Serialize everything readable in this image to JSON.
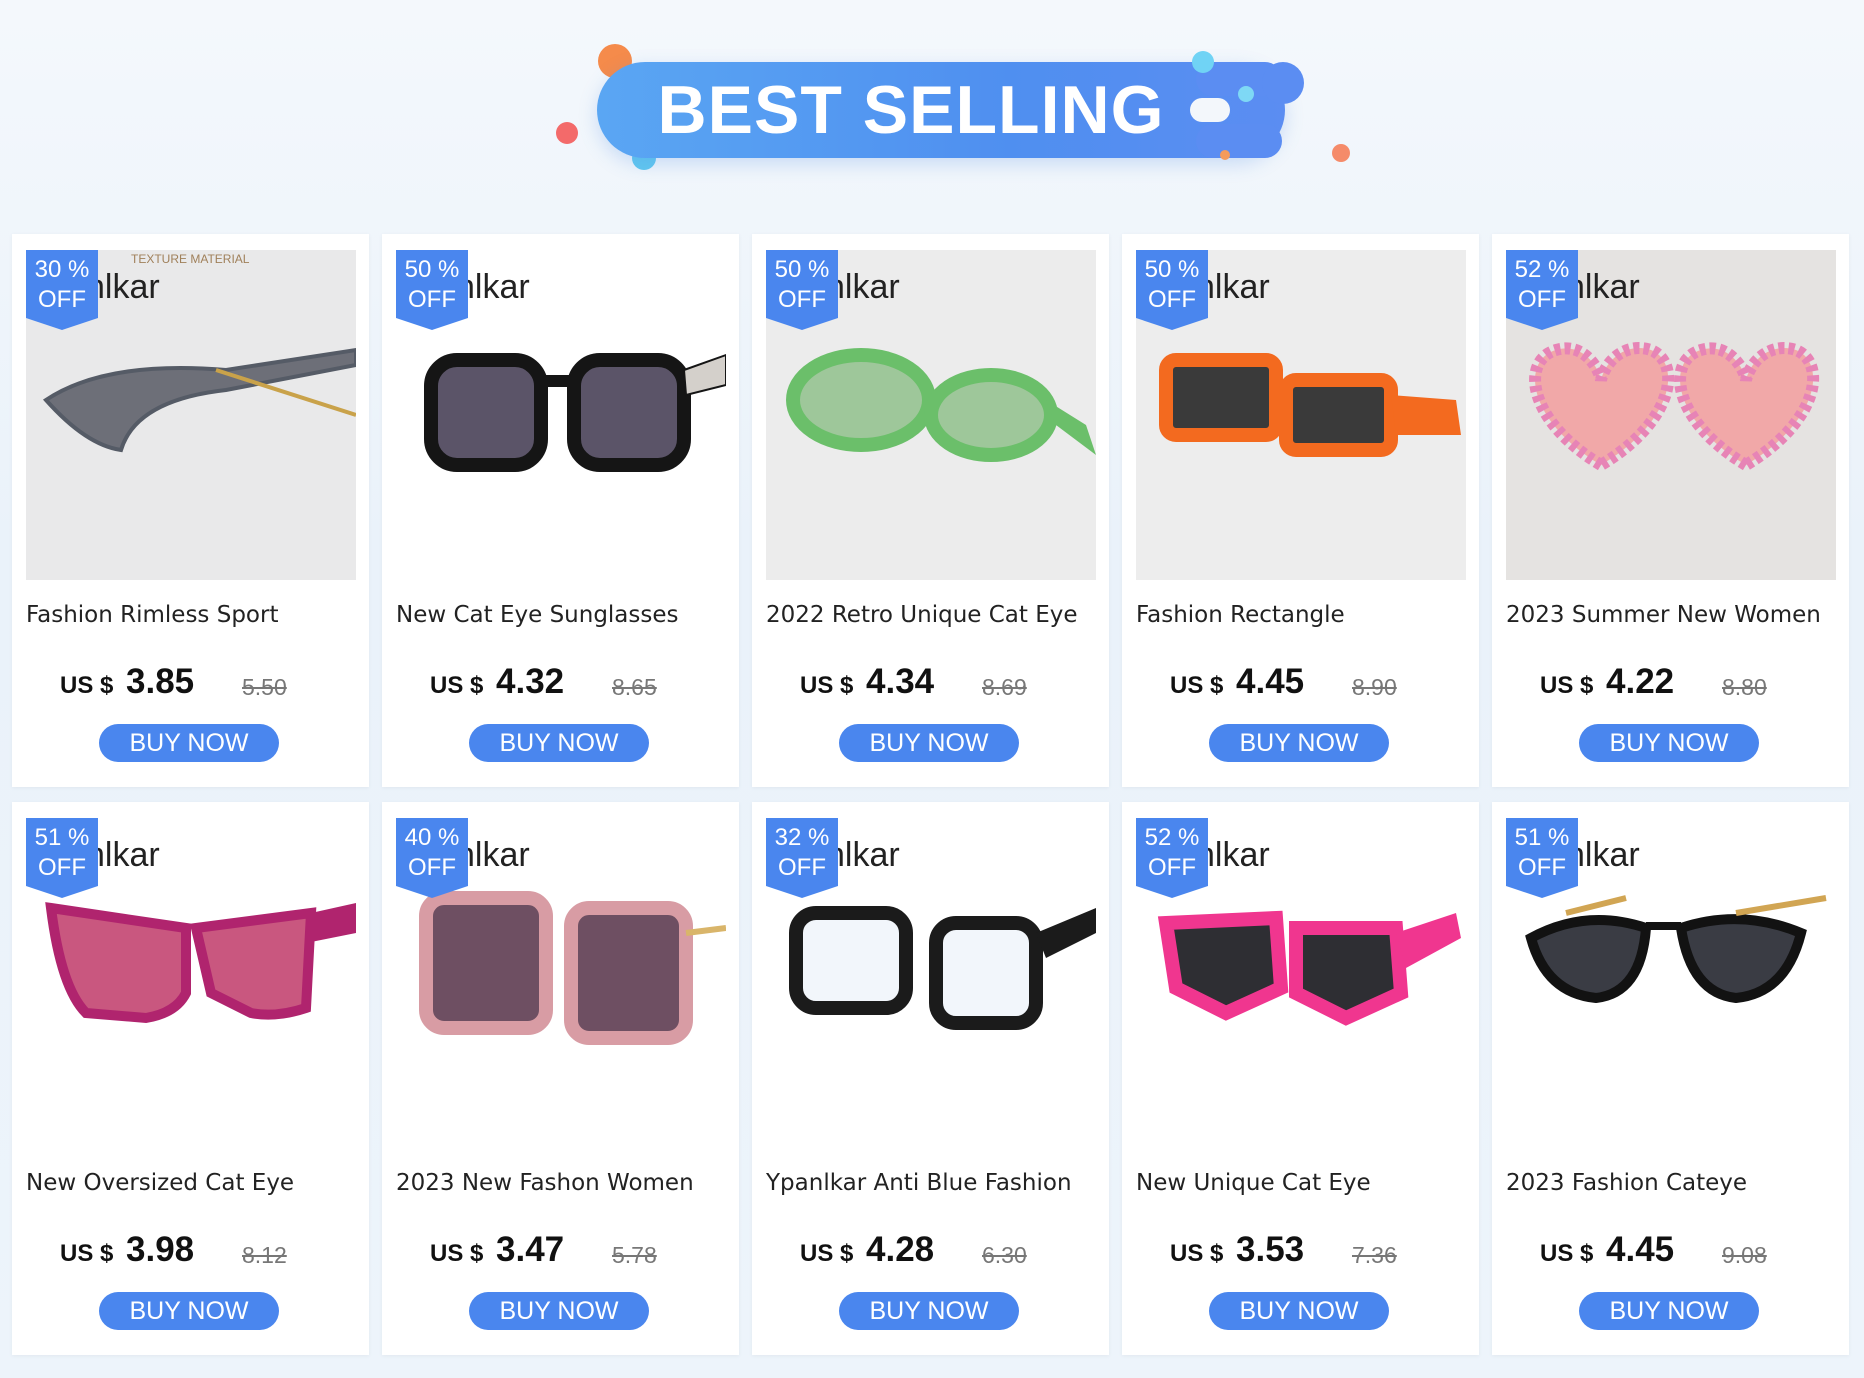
{
  "banner": {
    "title": "BEST SELLING"
  },
  "brand_text": "nlkar",
  "badge_off_label": "OFF",
  "currency": "US $",
  "buy_label": "BUY NOW",
  "products": [
    {
      "discount": "30 %",
      "title": "Fashion Rimless Sport",
      "price": "3.85",
      "old_price": "5.50",
      "image_caption": "TEXTURE MATERIAL",
      "frame_color": "#555b66",
      "lens_color": "#6d6f78",
      "bg": "#e9e9ea"
    },
    {
      "discount": "50 %",
      "title": "New Cat Eye Sunglasses",
      "price": "4.32",
      "old_price": "8.65",
      "frame_color": "#151515",
      "lens_color": "#5b5468",
      "bg": "#ffffff"
    },
    {
      "discount": "50 %",
      "title": "2022 Retro Unique Cat Eye",
      "price": "4.34",
      "old_price": "8.69",
      "frame_color": "#6bbf6a",
      "lens_color": "#9ec79a",
      "bg": "#ececec"
    },
    {
      "discount": "50 %",
      "title": "Fashion Rectangle",
      "price": "4.45",
      "old_price": "8.90",
      "frame_color": "#f36a1f",
      "lens_color": "#3a3a3a",
      "bg": "#ededed"
    },
    {
      "discount": "52 %",
      "title": "2023 Summer New Women",
      "price": "4.22",
      "old_price": "8.80",
      "frame_color": "#e784b6",
      "lens_color": "#f1a8a8",
      "bg": "#e5e3e1"
    },
    {
      "discount": "51 %",
      "title": "New Oversized Cat Eye",
      "price": "3.98",
      "old_price": "8.12",
      "frame_color": "#b0246e",
      "lens_color": "#c9577f",
      "bg": "#ffffff"
    },
    {
      "discount": "40 %",
      "title": "2023 New Fashon Women",
      "price": "3.47",
      "old_price": "5.78",
      "frame_color": "#d89ca4",
      "lens_color": "#6e4f62",
      "bg": "#ffffff"
    },
    {
      "discount": "32 %",
      "title": "Ypanlkar Anti Blue Fashion",
      "price": "4.28",
      "old_price": "6.30",
      "frame_color": "#1b1b1b",
      "lens_color": "#f2f6fb",
      "bg": "#ffffff"
    },
    {
      "discount": "52 %",
      "title": "New Unique Cat Eye",
      "price": "3.53",
      "old_price": "7.36",
      "frame_color": "#f0368f",
      "lens_color": "#2e2e33",
      "bg": "#ffffff"
    },
    {
      "discount": "51 %",
      "title": "2023 Fashion Cateye",
      "price": "4.45",
      "old_price": "9.08",
      "frame_color": "#121212",
      "lens_color": "#3a3c44",
      "bg": "#ffffff"
    }
  ]
}
